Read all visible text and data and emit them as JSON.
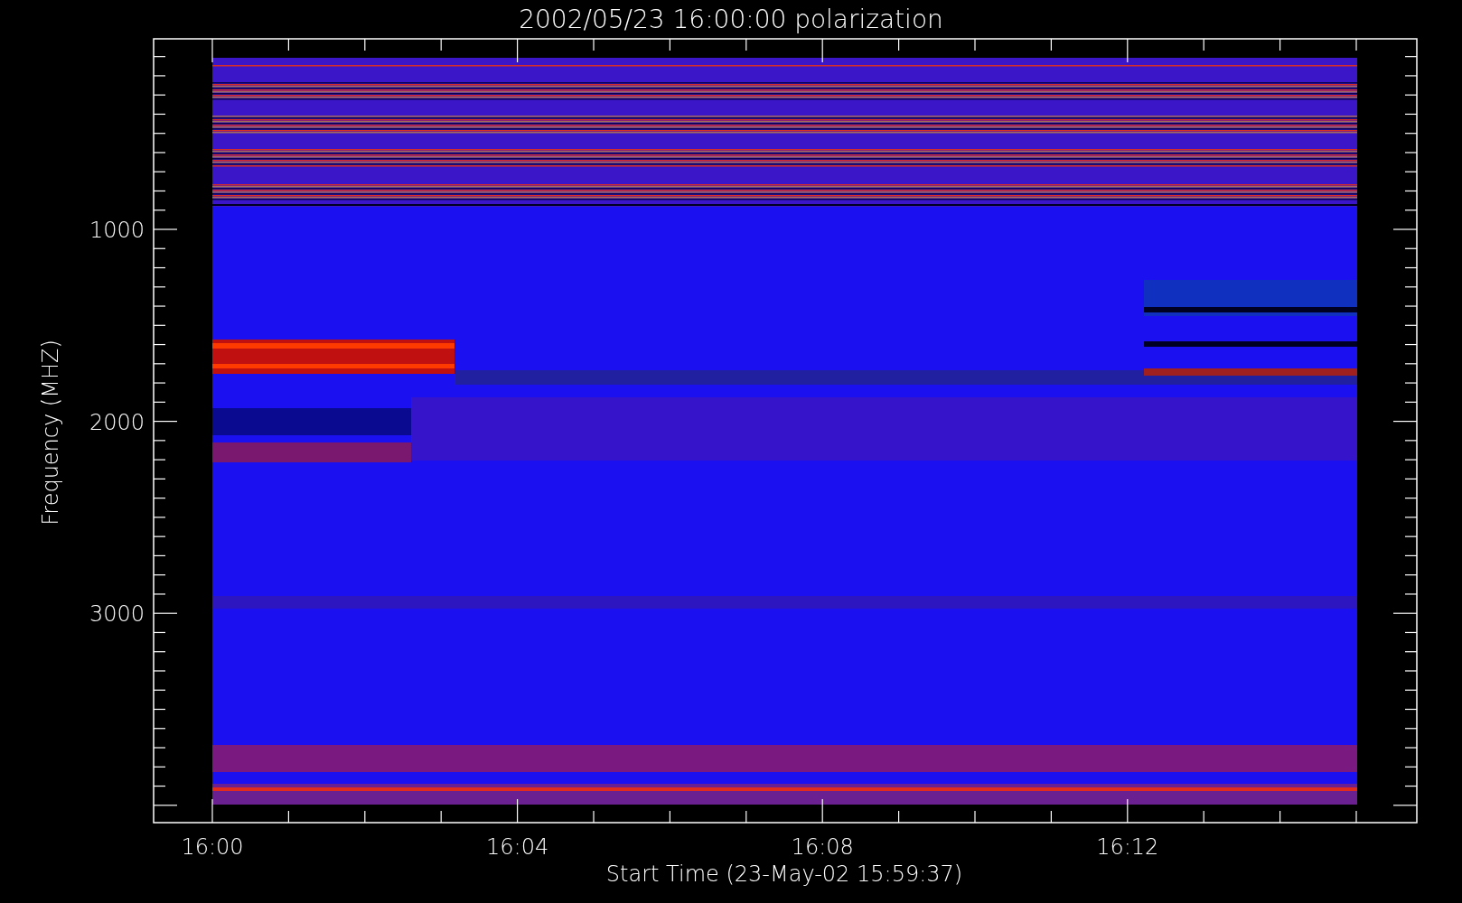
{
  "title": "2002/05/23 16:00:00 polarization",
  "y_axis": {
    "label": "Frequency (MHZ)",
    "ticks": [
      "1000",
      "2000",
      "3000"
    ]
  },
  "x_axis": {
    "label": "Start Time (23-May-02 15:59:37)",
    "ticks": [
      "16:00",
      "16:04",
      "16:08",
      "16:12"
    ]
  }
}
